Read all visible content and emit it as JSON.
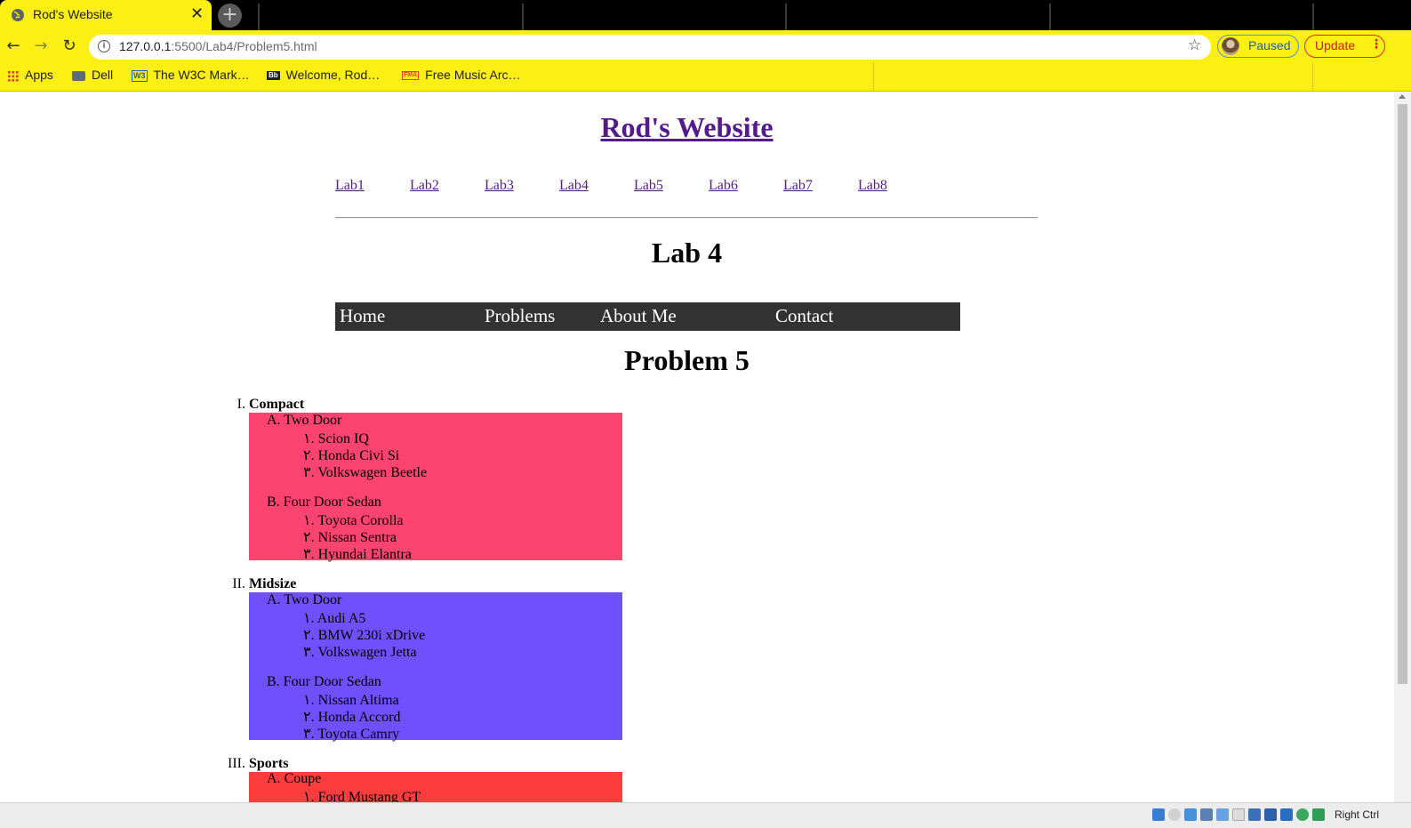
{
  "browser": {
    "tab_title": "Rod's Website",
    "tab_close_glyph": "✕",
    "new_tab_glyph": "+",
    "url_host": "127.0.0.1",
    "url_path": ":5500/Lab4/Problem5.html",
    "profile_label": "Paused",
    "update_label": "Update",
    "menu_glyph": "⋮",
    "star_glyph": "☆",
    "back_glyph": "←",
    "forward_glyph": "→",
    "reload_glyph": "↻",
    "bookmarks": [
      {
        "label": "Apps",
        "icon": "apps-grid-icon"
      },
      {
        "label": "Dell",
        "icon": "folder-icon"
      },
      {
        "label": "The W3C Mark…",
        "icon": "w3c-icon"
      },
      {
        "label": "Welcome, Rod…",
        "icon": "blackboard-icon"
      },
      {
        "label": "Free Music Arc…",
        "icon": "fma-icon"
      }
    ],
    "bookmark_icon_text": {
      "w3c": "W3",
      "bb": "Bb",
      "fma": "FMA"
    },
    "accent_color": "#fbef14"
  },
  "page": {
    "site_title": "Rod's Website",
    "lab_links": [
      "Lab1",
      "Lab2",
      "Lab3",
      "Lab4",
      "Lab5",
      "Lab6",
      "Lab7",
      "Lab8"
    ],
    "lab_heading": "Lab 4",
    "nav": [
      "Home",
      "Problems",
      "About Me",
      "Contact"
    ],
    "problem_heading": "Problem 5",
    "categories": [
      {
        "marker": "I.",
        "name": "Compact",
        "color": "#fd4470",
        "groups": [
          {
            "marker": "A.",
            "name": "Two Door",
            "items": [
              {
                "marker": "١.",
                "name": "Scion IQ"
              },
              {
                "marker": "٢.",
                "name": "Honda Civi Si"
              },
              {
                "marker": "٣.",
                "name": "Volkswagen Beetle"
              }
            ]
          },
          {
            "marker": "B.",
            "name": "Four Door Sedan",
            "items": [
              {
                "marker": "١.",
                "name": "Toyota Corolla"
              },
              {
                "marker": "٢.",
                "name": "Nissan Sentra"
              },
              {
                "marker": "٣.",
                "name": "Hyundai Elantra"
              }
            ]
          }
        ]
      },
      {
        "marker": "II.",
        "name": "Midsize",
        "color": "#6e51fd",
        "groups": [
          {
            "marker": "A.",
            "name": "Two Door",
            "items": [
              {
                "marker": "١.",
                "name": "Audi A5"
              },
              {
                "marker": "٢.",
                "name": "BMW 230i xDrive"
              },
              {
                "marker": "٣.",
                "name": "Volkswagen Jetta"
              }
            ]
          },
          {
            "marker": "B.",
            "name": "Four Door Sedan",
            "items": [
              {
                "marker": "١.",
                "name": "Nissan Altima"
              },
              {
                "marker": "٢.",
                "name": "Honda Accord"
              },
              {
                "marker": "٣.",
                "name": "Toyota Camry"
              }
            ]
          }
        ]
      },
      {
        "marker": "III.",
        "name": "Sports",
        "color": "#fd3d3d",
        "groups": [
          {
            "marker": "A.",
            "name": "Coupe",
            "items": [
              {
                "marker": "١.",
                "name": "Ford Mustang GT"
              }
            ]
          }
        ]
      }
    ]
  },
  "vm_statusbar": {
    "host_key": "Right Ctrl"
  }
}
